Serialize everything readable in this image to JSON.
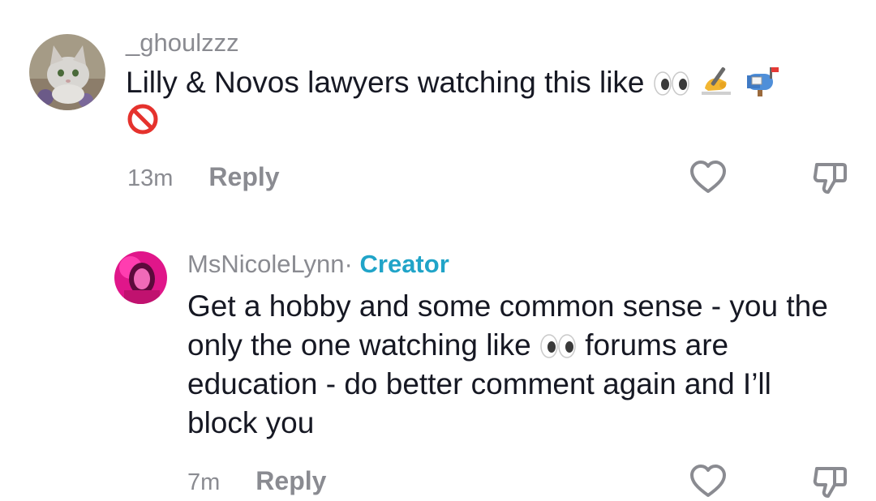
{
  "comments": [
    {
      "username": "_ghoulzzz",
      "text": "Lilly & Novos lawyers watching this like",
      "emojis": [
        "eyes-emoji",
        "writing-hand-emoji",
        "mailbox-emoji",
        "prohibited-emoji"
      ],
      "time": "13m",
      "reply_label": "Reply"
    },
    {
      "username": "MsNicoleLynn",
      "separator": "·",
      "badge": "Creator",
      "text_part1": "Get a hobby and some common sense - you the only the one watching like",
      "text_part2": "forums are education - do better comment again and I’ll block you",
      "emojis": [
        "eyes-emoji"
      ],
      "time": "7m",
      "reply_label": "Reply"
    }
  ],
  "colors": {
    "text": "#161823",
    "muted": "#8a8b91",
    "creator_badge": "#20a4c8"
  }
}
